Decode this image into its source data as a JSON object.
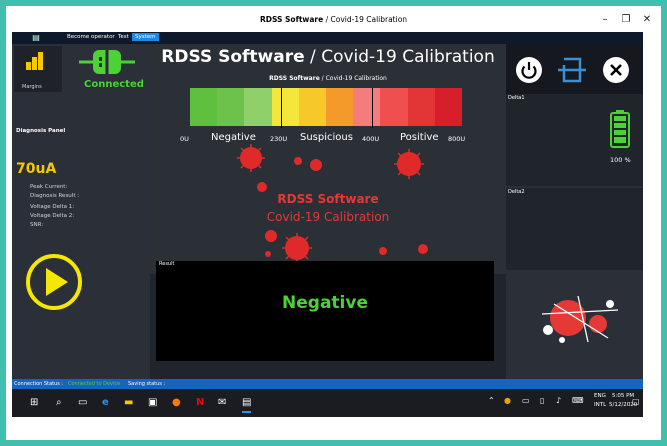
{
  "window": {
    "title_bold": "RDSS Software",
    "title_rest": " / Covid-19 Calibration",
    "min": "–",
    "max": "❐",
    "close": "✕"
  },
  "menu": {
    "items": [
      "Become operator",
      "Test",
      "System"
    ],
    "active": "System"
  },
  "left": {
    "margin_label": "Margins",
    "connected": "Connected",
    "diagnosis_panel": "Diagnosis Panel",
    "current_value": "70uA",
    "fields": [
      "Peak Current:",
      "Diagnosis Result :",
      "Voltage Delta 1:",
      "Voltage Delta 2:",
      "SNR:"
    ]
  },
  "center": {
    "title_bold": "RDSS Software",
    "title_sep": " / ",
    "title_rest": "Covid-19 Calibration",
    "subtitle_bold": "RDSS Software",
    "subtitle_rest": " / Covid-19 Calibration",
    "ticks": [
      "0U",
      "230U",
      "400U",
      "800U"
    ],
    "zones": [
      "Negative",
      "Suspicious",
      "Positive"
    ],
    "scale_colors": [
      "#5fbf3f",
      "#6cc24a",
      "#8fd06a",
      "#f2e73a",
      "#f7c82a",
      "#f39a2a",
      "#f47c7c",
      "#ef4f4f",
      "#e23535",
      "#d61f2b"
    ],
    "brand_line1": "RDSS Software",
    "brand_line2": "Covid-19 Calibration"
  },
  "result": {
    "header": "Result",
    "value": "Negative"
  },
  "right": {
    "delta1": "Delta1",
    "delta2": "Delta2",
    "battery": "100 %"
  },
  "status": {
    "connection_label": "Connection Status :",
    "connection_value": "Connected to Device",
    "saving_label": "Saving status :"
  },
  "taskbar": {
    "lang_top": "ENG",
    "lang_bottom": "INTL",
    "time": "5:05 PM",
    "date": "5/12/2020"
  },
  "colors": {
    "accent": "#1e88e5",
    "green": "#4cd137",
    "yellow": "#f5c800",
    "red": "#e53935"
  }
}
